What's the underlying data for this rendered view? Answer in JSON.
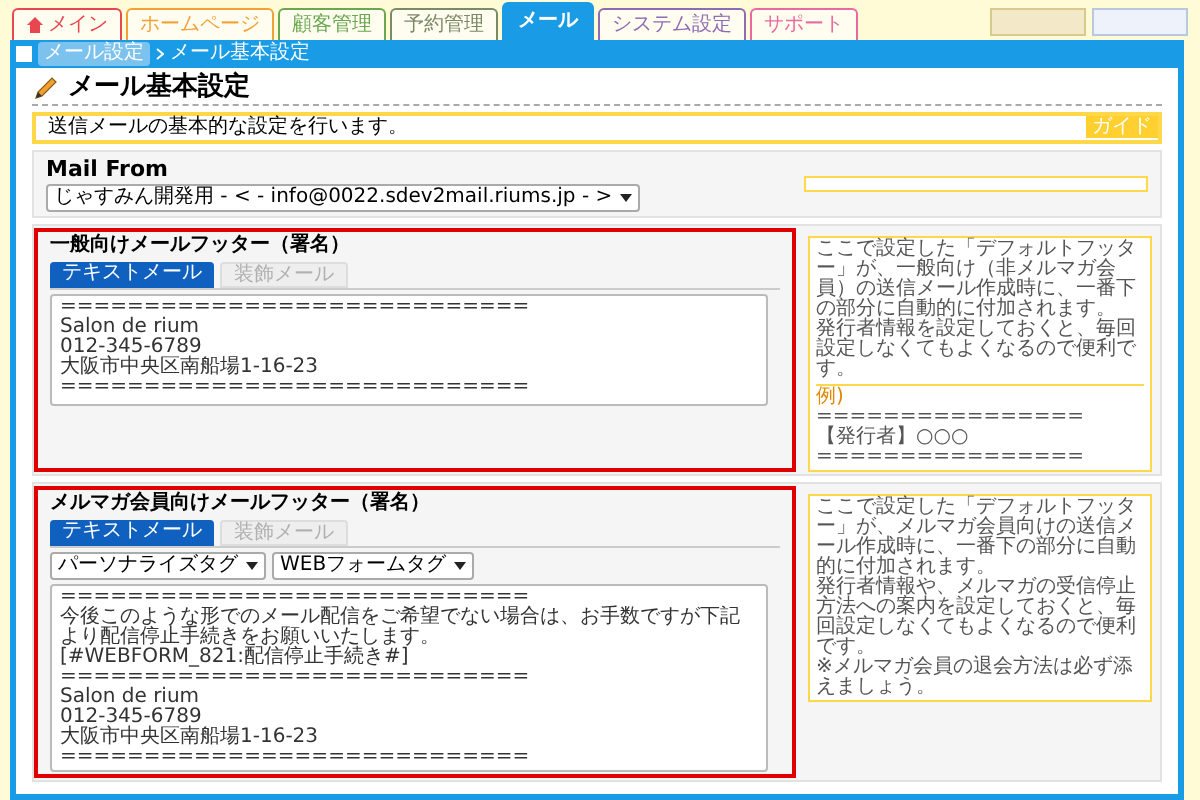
{
  "nav_tabs": [
    {
      "label": "メイン",
      "color": "#e8474f",
      "selected": false,
      "home": true
    },
    {
      "label": "ホームページ",
      "color": "#f2a13a",
      "selected": false,
      "home": false
    },
    {
      "label": "顧客管理",
      "color": "#6aa84f",
      "selected": false,
      "home": false
    },
    {
      "label": "予約管理",
      "color": "#7a8a66",
      "selected": false,
      "home": false
    },
    {
      "label": "メール",
      "color": "#1a9be6",
      "selected": true,
      "home": false
    },
    {
      "label": "システム設定",
      "color": "#8e6bb5",
      "selected": false,
      "home": false
    },
    {
      "label": "サポート",
      "color": "#e86aa0",
      "selected": false,
      "home": false
    }
  ],
  "breadcrumb": {
    "parent": "メール設定",
    "current": "メール基本設定"
  },
  "page_title": "メール基本設定",
  "guide": {
    "text": "送信メールの基本的な設定を行います。",
    "badge": "ガイド"
  },
  "mail_from": {
    "heading": "Mail From",
    "value": "じゃすみん開発用 - < - info@0022.sdev2mail.riums.jp - >"
  },
  "footers": [
    {
      "heading": "一般向けメールフッター（署名）",
      "highlighted": true,
      "tabs": [
        {
          "label": "テキストメール",
          "selected": true
        },
        {
          "label": "装飾メール",
          "selected": false
        }
      ],
      "body": [
        "============================",
        "Salon de rium",
        "012-345-6789",
        "大阪市中央区南船場1-16-23",
        "============================"
      ],
      "note": {
        "paragraphs": [
          "ここで設定した「デフォルトフッター」が、一般向け（非メルマガ会員）の送信メール作成時に、一番下の部分に自動的に付加されます。",
          "発行者情報を設定しておくと、毎回設定しなくてもよくなるので便利です。"
        ],
        "example": [
          "例)",
          "================",
          "【発行者】○○○",
          "================"
        ]
      }
    },
    {
      "heading": "メルマガ会員向けメールフッター（署名）",
      "highlighted": true,
      "tabs": [
        {
          "label": "テキストメール",
          "selected": true
        },
        {
          "label": "装飾メール",
          "selected": false
        }
      ],
      "tag_selects": [
        "パーソナライズタグ",
        "WEBフォームタグ"
      ],
      "body": [
        "============================",
        "今後このような形でのメール配信をご希望でない場合は、お手数ですが下記より配信停止手続きをお願いいたします。",
        "[#WEBFORM_821:配信停止手続き#]",
        "============================",
        "Salon de rium",
        "012-345-6789",
        "大阪市中央区南船場1-16-23",
        "============================"
      ],
      "note": {
        "paragraphs": [
          "ここで設定した「デフォルトフッター」が、メルマガ会員向けの送信メール作成時に、一番下の部分に自動的に付加されます。",
          "発行者情報や、メルマガの受信停止方法への案内を設定しておくと、毎回設定しなくてもよくなるので便利です。",
          "※メルマガ会員の退会方法は必ず添えましょう。"
        ]
      }
    }
  ]
}
